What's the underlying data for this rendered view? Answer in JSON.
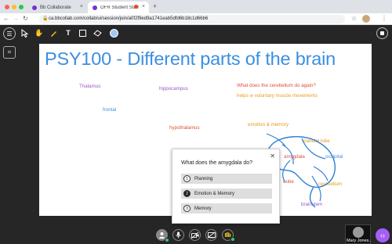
{
  "browser": {
    "tabs": [
      {
        "label": "Bb Collaborate",
        "active": false
      },
      {
        "label": "OFR Student Staff Training",
        "active": true
      }
    ],
    "new_tab_icon": "plus-icon",
    "url": "ca.bbcollab.com/collab/ui/session/join/a0f2f9ed9a1741eab5dfd6b18c1d66b6"
  },
  "toolbar": {
    "tools": [
      "menu-icon",
      "select-icon",
      "pan-icon",
      "pen-icon",
      "text-icon",
      "shape-icon",
      "eraser-icon",
      "color-icon"
    ]
  },
  "board": {
    "title": "PSY100 - Different parts of the brain",
    "labels": {
      "thalamus": "Thalamus",
      "hippocampus": "hippocampus",
      "frontal": "frontal",
      "hypothalamus": "hypothalamus",
      "cerebellum_q": "What does the cerebellum do again?",
      "cerebellum_a": "helps w voluntary muscle movements",
      "emotion": "emotion & memory",
      "parietal": "parietal lobe",
      "amygdala": "amygdala",
      "occipital": "occipital",
      "lobe": "Lobe",
      "cerebellum": "cerebellum",
      "brainstem": "brainstem"
    }
  },
  "poll": {
    "question": "What does the amygdala do?",
    "options": [
      {
        "num": "1",
        "label": "Planning",
        "selected": false
      },
      {
        "num": "2",
        "label": "Emotion & Memory",
        "selected": true
      },
      {
        "num": "3",
        "label": "Memory",
        "selected": false
      }
    ]
  },
  "participant": {
    "name": "Mary Jones..."
  },
  "colors": {
    "title": "#3b8fe0",
    "accent": "#a45ef5",
    "drawing": "#2d7fd6"
  }
}
